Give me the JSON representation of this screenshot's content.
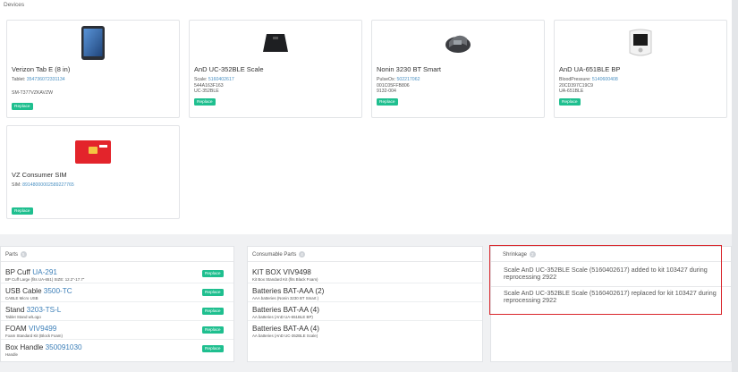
{
  "devices": {
    "title": "Devices",
    "replace_label": "Replace",
    "cards": [
      {
        "name": "Verizon Tab E (8 in)",
        "label_prefix": "Tablet: ",
        "link": "354736072331134",
        "lines": [
          "",
          "SM-T377VZKAVZW"
        ],
        "icon": "tablet-icon"
      },
      {
        "name": "AnD UC-352BLE Scale",
        "label_prefix": "Scale: ",
        "link": "5160402617",
        "lines": [
          "544A163F163",
          "UC-352BLE"
        ],
        "icon": "scale-icon"
      },
      {
        "name": "Nonin 3230 BT Smart",
        "label_prefix": "PulseOx: ",
        "link": "502217062",
        "lines": [
          "001C05FFB806",
          "9132-004"
        ],
        "icon": "pulse-oximeter-icon"
      },
      {
        "name": "AnD UA-651BLE BP",
        "label_prefix": "BloodPressure: ",
        "link": "5140600408",
        "lines": [
          "20CD397C19C9",
          "UA-651BLE"
        ],
        "icon": "blood-pressure-monitor-icon"
      },
      {
        "name": "VZ Consumer SIM",
        "label_prefix": "SIM: ",
        "link": "89148000002589227765",
        "lines": [],
        "icon": "sim-card-icon"
      }
    ]
  },
  "parts": {
    "title": "Parts",
    "count": "5",
    "replace_label": "Replace",
    "items": [
      {
        "name": "BP Cuff ",
        "code": "UA-291",
        "desc": "BP Cuff Large (fits UA-651) SIZE: 12.2\"-17.7\""
      },
      {
        "name": "USB Cable ",
        "code": "3500-TC",
        "desc": "CABLE Micro USB"
      },
      {
        "name": "Stand ",
        "code": "3203-TS-L",
        "desc": "Tablet Stand w/Logo"
      },
      {
        "name": "FOAM ",
        "code": "VIV9499",
        "desc": "Foam Standard Kit (Block Foam)"
      },
      {
        "name": "Box Handle ",
        "code": "350091030",
        "desc": "Handle"
      }
    ]
  },
  "consumables": {
    "title": "Consumable Parts",
    "count": "4",
    "items": [
      {
        "name": "KIT BOX VIV9498",
        "desc": "Kit Box Standard Kit (fits Black Foam)"
      },
      {
        "name": "Batteries BAT-AAA (2)",
        "desc": "AAA batteries (Nonin 3230 BT Smart )"
      },
      {
        "name": "Batteries BAT-AA (4)",
        "desc": "AA batteries (AnD UA-651BLE BP)"
      },
      {
        "name": "Batteries BAT-AA (4)",
        "desc": "AA batteries (AnD UC-352BLE Scale)"
      }
    ]
  },
  "shrinkage": {
    "title": "Shrinkage",
    "count": "2",
    "items": [
      "Scale AnD UC-352BLE Scale (5160402617) added to kit 103427 during reprocessing 2922",
      "Scale AnD UC-352BLE Scale (5160402617) replaced for kit 103427 during reprocessing 2922"
    ]
  },
  "colors": {
    "replace_button": "#1fbf8f",
    "link": "#4a90c2",
    "highlight_border": "#d9262b"
  }
}
